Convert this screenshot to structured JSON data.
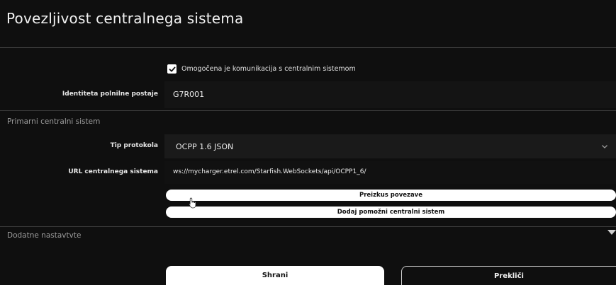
{
  "page": {
    "title": "Povezljivost centralnega sistema"
  },
  "communication": {
    "enable_label": "Omogočena je komunikacija s centralnim sistemom",
    "enabled": true
  },
  "identity": {
    "label": "Identiteta polnilne postaje",
    "value": "G7R001"
  },
  "primary_system": {
    "section_title": "Primarni centralni sistem",
    "protocol_label": "Tip protokola",
    "protocol_value": "OCPP 1.6 JSON",
    "url_label": "URL centralnega sistema",
    "url_value": "ws://mycharger.etrel.com/Starfish.WebSockets/api/OCPP1_6/",
    "test_button": "Preizkus povezave",
    "add_secondary_button": "Dodaj pomožni centralni sistem"
  },
  "additional": {
    "section_title": "Dodatne nastavtvte"
  },
  "footer": {
    "save_label": "Shrani",
    "cancel_label": "Prekliči"
  },
  "icons": {
    "checkbox": "check-icon",
    "dropdown": "chevron-down-icon",
    "expand": "caret-down-icon",
    "cursor": "hand-pointer-icon"
  }
}
